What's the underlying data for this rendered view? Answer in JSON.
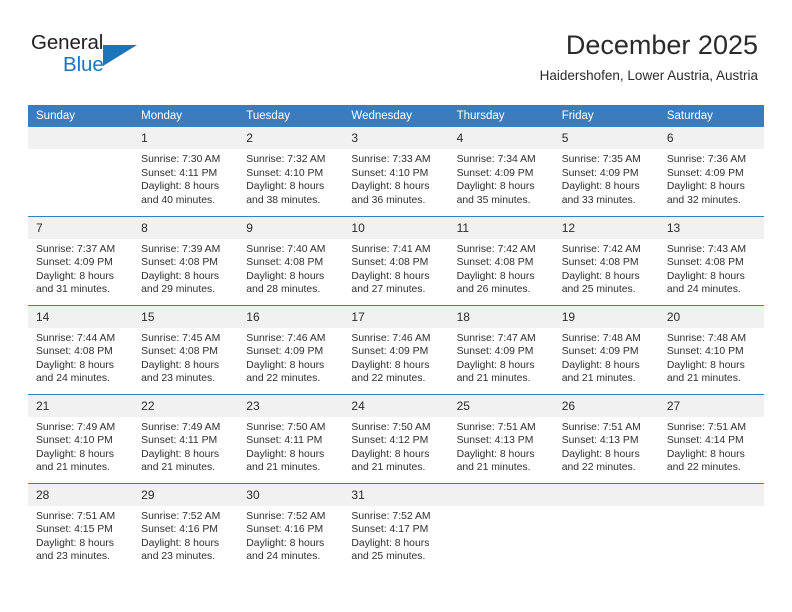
{
  "brand": {
    "name_top": "General",
    "name_bottom": "Blue",
    "accent_color": "#1b75bb",
    "triangle_icon": "triangle-right-icon"
  },
  "header": {
    "title": "December 2025",
    "subtitle": "Haidershofen, Lower Austria, Austria"
  },
  "calendar": {
    "header_bg": "#3a7cbe",
    "daynum_bg": "#f1f1f1",
    "weekday_headers": [
      "Sunday",
      "Monday",
      "Tuesday",
      "Wednesday",
      "Thursday",
      "Friday",
      "Saturday"
    ],
    "weeks": [
      [
        {
          "day": "",
          "sunrise": "",
          "sunset": "",
          "daylight_line1": "",
          "daylight_line2": "",
          "empty": true
        },
        {
          "day": "1",
          "sunrise": "Sunrise: 7:30 AM",
          "sunset": "Sunset: 4:11 PM",
          "daylight_line1": "Daylight: 8 hours",
          "daylight_line2": "and 40 minutes."
        },
        {
          "day": "2",
          "sunrise": "Sunrise: 7:32 AM",
          "sunset": "Sunset: 4:10 PM",
          "daylight_line1": "Daylight: 8 hours",
          "daylight_line2": "and 38 minutes."
        },
        {
          "day": "3",
          "sunrise": "Sunrise: 7:33 AM",
          "sunset": "Sunset: 4:10 PM",
          "daylight_line1": "Daylight: 8 hours",
          "daylight_line2": "and 36 minutes."
        },
        {
          "day": "4",
          "sunrise": "Sunrise: 7:34 AM",
          "sunset": "Sunset: 4:09 PM",
          "daylight_line1": "Daylight: 8 hours",
          "daylight_line2": "and 35 minutes."
        },
        {
          "day": "5",
          "sunrise": "Sunrise: 7:35 AM",
          "sunset": "Sunset: 4:09 PM",
          "daylight_line1": "Daylight: 8 hours",
          "daylight_line2": "and 33 minutes."
        },
        {
          "day": "6",
          "sunrise": "Sunrise: 7:36 AM",
          "sunset": "Sunset: 4:09 PM",
          "daylight_line1": "Daylight: 8 hours",
          "daylight_line2": "and 32 minutes."
        }
      ],
      [
        {
          "day": "7",
          "sunrise": "Sunrise: 7:37 AM",
          "sunset": "Sunset: 4:09 PM",
          "daylight_line1": "Daylight: 8 hours",
          "daylight_line2": "and 31 minutes."
        },
        {
          "day": "8",
          "sunrise": "Sunrise: 7:39 AM",
          "sunset": "Sunset: 4:08 PM",
          "daylight_line1": "Daylight: 8 hours",
          "daylight_line2": "and 29 minutes."
        },
        {
          "day": "9",
          "sunrise": "Sunrise: 7:40 AM",
          "sunset": "Sunset: 4:08 PM",
          "daylight_line1": "Daylight: 8 hours",
          "daylight_line2": "and 28 minutes."
        },
        {
          "day": "10",
          "sunrise": "Sunrise: 7:41 AM",
          "sunset": "Sunset: 4:08 PM",
          "daylight_line1": "Daylight: 8 hours",
          "daylight_line2": "and 27 minutes."
        },
        {
          "day": "11",
          "sunrise": "Sunrise: 7:42 AM",
          "sunset": "Sunset: 4:08 PM",
          "daylight_line1": "Daylight: 8 hours",
          "daylight_line2": "and 26 minutes."
        },
        {
          "day": "12",
          "sunrise": "Sunrise: 7:42 AM",
          "sunset": "Sunset: 4:08 PM",
          "daylight_line1": "Daylight: 8 hours",
          "daylight_line2": "and 25 minutes."
        },
        {
          "day": "13",
          "sunrise": "Sunrise: 7:43 AM",
          "sunset": "Sunset: 4:08 PM",
          "daylight_line1": "Daylight: 8 hours",
          "daylight_line2": "and 24 minutes."
        }
      ],
      [
        {
          "day": "14",
          "sunrise": "Sunrise: 7:44 AM",
          "sunset": "Sunset: 4:08 PM",
          "daylight_line1": "Daylight: 8 hours",
          "daylight_line2": "and 24 minutes."
        },
        {
          "day": "15",
          "sunrise": "Sunrise: 7:45 AM",
          "sunset": "Sunset: 4:08 PM",
          "daylight_line1": "Daylight: 8 hours",
          "daylight_line2": "and 23 minutes."
        },
        {
          "day": "16",
          "sunrise": "Sunrise: 7:46 AM",
          "sunset": "Sunset: 4:09 PM",
          "daylight_line1": "Daylight: 8 hours",
          "daylight_line2": "and 22 minutes."
        },
        {
          "day": "17",
          "sunrise": "Sunrise: 7:46 AM",
          "sunset": "Sunset: 4:09 PM",
          "daylight_line1": "Daylight: 8 hours",
          "daylight_line2": "and 22 minutes."
        },
        {
          "day": "18",
          "sunrise": "Sunrise: 7:47 AM",
          "sunset": "Sunset: 4:09 PM",
          "daylight_line1": "Daylight: 8 hours",
          "daylight_line2": "and 21 minutes."
        },
        {
          "day": "19",
          "sunrise": "Sunrise: 7:48 AM",
          "sunset": "Sunset: 4:09 PM",
          "daylight_line1": "Daylight: 8 hours",
          "daylight_line2": "and 21 minutes."
        },
        {
          "day": "20",
          "sunrise": "Sunrise: 7:48 AM",
          "sunset": "Sunset: 4:10 PM",
          "daylight_line1": "Daylight: 8 hours",
          "daylight_line2": "and 21 minutes."
        }
      ],
      [
        {
          "day": "21",
          "sunrise": "Sunrise: 7:49 AM",
          "sunset": "Sunset: 4:10 PM",
          "daylight_line1": "Daylight: 8 hours",
          "daylight_line2": "and 21 minutes."
        },
        {
          "day": "22",
          "sunrise": "Sunrise: 7:49 AM",
          "sunset": "Sunset: 4:11 PM",
          "daylight_line1": "Daylight: 8 hours",
          "daylight_line2": "and 21 minutes."
        },
        {
          "day": "23",
          "sunrise": "Sunrise: 7:50 AM",
          "sunset": "Sunset: 4:11 PM",
          "daylight_line1": "Daylight: 8 hours",
          "daylight_line2": "and 21 minutes."
        },
        {
          "day": "24",
          "sunrise": "Sunrise: 7:50 AM",
          "sunset": "Sunset: 4:12 PM",
          "daylight_line1": "Daylight: 8 hours",
          "daylight_line2": "and 21 minutes."
        },
        {
          "day": "25",
          "sunrise": "Sunrise: 7:51 AM",
          "sunset": "Sunset: 4:13 PM",
          "daylight_line1": "Daylight: 8 hours",
          "daylight_line2": "and 21 minutes."
        },
        {
          "day": "26",
          "sunrise": "Sunrise: 7:51 AM",
          "sunset": "Sunset: 4:13 PM",
          "daylight_line1": "Daylight: 8 hours",
          "daylight_line2": "and 22 minutes."
        },
        {
          "day": "27",
          "sunrise": "Sunrise: 7:51 AM",
          "sunset": "Sunset: 4:14 PM",
          "daylight_line1": "Daylight: 8 hours",
          "daylight_line2": "and 22 minutes."
        }
      ],
      [
        {
          "day": "28",
          "sunrise": "Sunrise: 7:51 AM",
          "sunset": "Sunset: 4:15 PM",
          "daylight_line1": "Daylight: 8 hours",
          "daylight_line2": "and 23 minutes."
        },
        {
          "day": "29",
          "sunrise": "Sunrise: 7:52 AM",
          "sunset": "Sunset: 4:16 PM",
          "daylight_line1": "Daylight: 8 hours",
          "daylight_line2": "and 23 minutes."
        },
        {
          "day": "30",
          "sunrise": "Sunrise: 7:52 AM",
          "sunset": "Sunset: 4:16 PM",
          "daylight_line1": "Daylight: 8 hours",
          "daylight_line2": "and 24 minutes."
        },
        {
          "day": "31",
          "sunrise": "Sunrise: 7:52 AM",
          "sunset": "Sunset: 4:17 PM",
          "daylight_line1": "Daylight: 8 hours",
          "daylight_line2": "and 25 minutes."
        },
        {
          "day": "",
          "sunrise": "",
          "sunset": "",
          "daylight_line1": "",
          "daylight_line2": "",
          "blank": true
        },
        {
          "day": "",
          "sunrise": "",
          "sunset": "",
          "daylight_line1": "",
          "daylight_line2": "",
          "blank": true
        },
        {
          "day": "",
          "sunrise": "",
          "sunset": "",
          "daylight_line1": "",
          "daylight_line2": "",
          "blank": true
        }
      ]
    ]
  }
}
